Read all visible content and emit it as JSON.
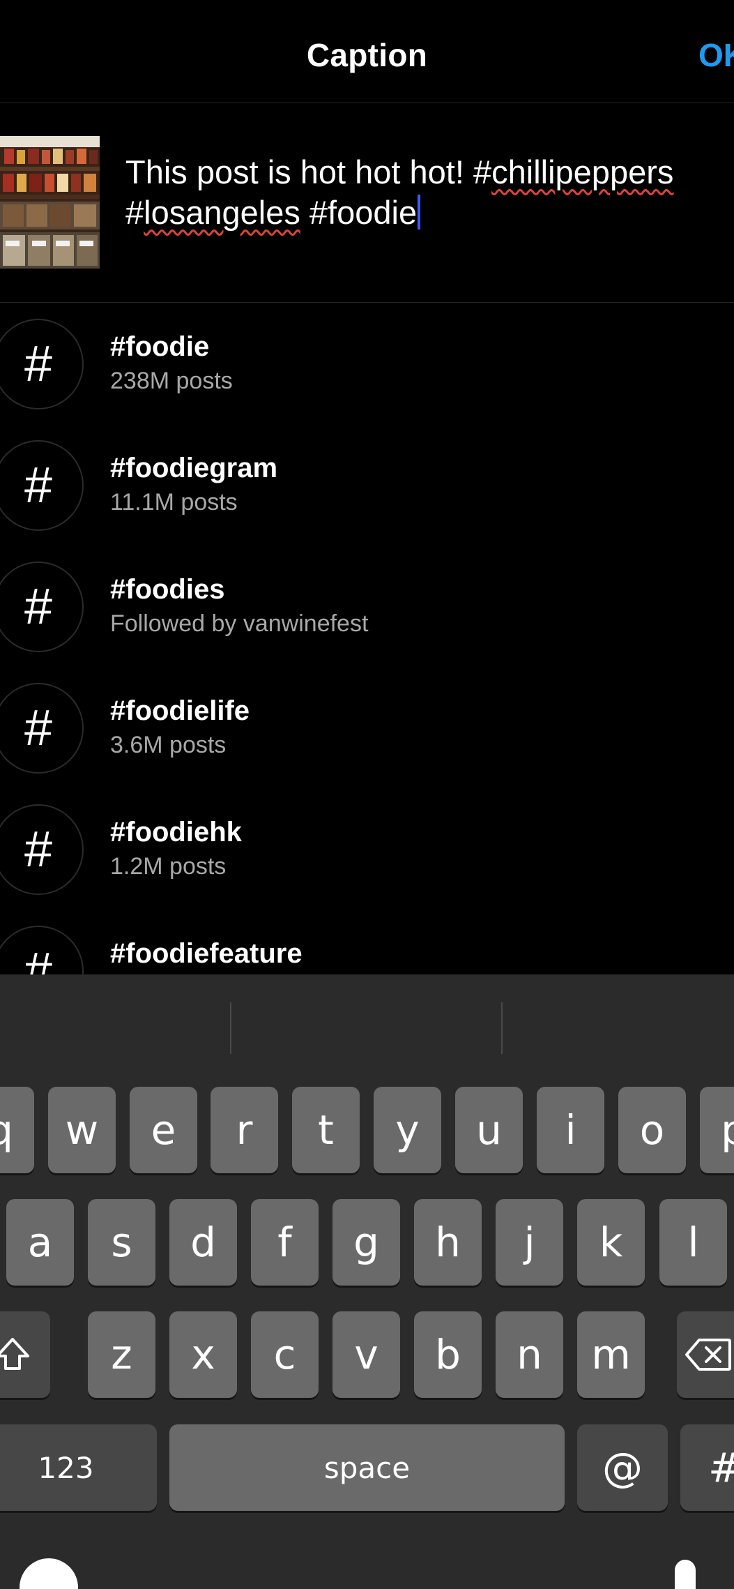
{
  "header": {
    "title": "Caption",
    "action_label": "OK"
  },
  "caption": {
    "part1": "This post is hot hot hot! #",
    "part1_sq": "chillipeppers",
    "part2": "#",
    "part2_sq": "losangeles",
    "part3": " #foodie"
  },
  "suggestions": [
    {
      "tag": "#foodie",
      "detail": "238M posts"
    },
    {
      "tag": "#foodiegram",
      "detail": "11.1M posts"
    },
    {
      "tag": "#foodies",
      "detail": "Followed by vanwinefest"
    },
    {
      "tag": "#foodielife",
      "detail": "3.6M posts"
    },
    {
      "tag": "#foodiehk",
      "detail": "1.2M posts"
    },
    {
      "tag": "#foodiefeature",
      "detail": ""
    }
  ],
  "keyboard": {
    "row1": [
      "q",
      "w",
      "e",
      "r",
      "t",
      "y",
      "u",
      "i",
      "o",
      "p"
    ],
    "row2": [
      "a",
      "s",
      "d",
      "f",
      "g",
      "h",
      "j",
      "k",
      "l"
    ],
    "row3": [
      "z",
      "x",
      "c",
      "v",
      "b",
      "n",
      "m"
    ],
    "numbers_label": "123",
    "space_label": "space",
    "at_label": "@",
    "hash_label": "#"
  },
  "colors": {
    "accent": "#1d9bf0",
    "background": "#000000",
    "keyboard_bg": "#2b2b2b",
    "key": "#6a6a6a",
    "key_dark": "#474747"
  },
  "icons": {
    "hashtag": "hashtag-icon",
    "shift": "shift-icon",
    "delete": "delete-icon",
    "emoji": "emoji-icon",
    "mic": "microphone-icon"
  }
}
